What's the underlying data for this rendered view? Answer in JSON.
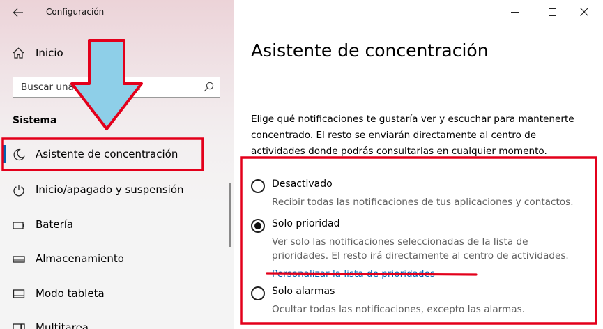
{
  "window": {
    "title": "Configuración",
    "controls": {
      "minimize": "minimize-icon",
      "maximize": "maximize-icon",
      "close": "close-icon"
    }
  },
  "sidebar": {
    "home_label": "Inicio",
    "search_placeholder": "Buscar una configuración",
    "section_title": "Sistema",
    "items": [
      {
        "label": "Asistente de concentración",
        "icon": "moon-icon",
        "active": true
      },
      {
        "label": "Inicio/apagado y suspensión",
        "icon": "power-icon"
      },
      {
        "label": "Batería",
        "icon": "battery-icon"
      },
      {
        "label": "Almacenamiento",
        "icon": "storage-icon"
      },
      {
        "label": "Modo tableta",
        "icon": "tablet-icon"
      },
      {
        "label": "Multitarea",
        "icon": "multitasking-icon"
      }
    ]
  },
  "main": {
    "title": "Asistente de concentración",
    "description": "Elige qué notificaciones te gustaría ver y escuchar para mantenerte concentrado. El resto se enviarán directamente al centro de actividades donde podrás consultarlas en cualquier momento.",
    "options": [
      {
        "label": "Desactivado",
        "description": "Recibir todas las notificaciones de tus aplicaciones y contactos.",
        "checked": false
      },
      {
        "label": "Solo prioridad",
        "description": "Ver solo las notificaciones seleccionadas de la lista de prioridades. El resto irá directamente al centro de actividades.",
        "link": "Personalizar la lista de prioridades",
        "checked": true
      },
      {
        "label": "Solo alarmas",
        "description": "Ocultar todas las notificaciones, excepto las alarmas.",
        "checked": false
      }
    ]
  },
  "colors": {
    "accent": "#0063b1",
    "annotation_red": "#e3001b",
    "arrow_fill": "#8ecfe8"
  }
}
